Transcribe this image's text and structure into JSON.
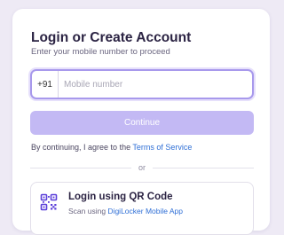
{
  "login": {
    "title": "Login or Create Account",
    "subtitle": "Enter your mobile number to proceed",
    "country_code": "+91",
    "phone_placeholder": "Mobile number",
    "phone_value": "",
    "continue_label": "Continue",
    "terms_prefix": "By continuing, I agree to the ",
    "terms_link": "Terms of Service",
    "divider_text": "or",
    "qr": {
      "icon": "qr-code-icon",
      "title": "Login using QR Code",
      "subtitle_prefix": "Scan using ",
      "subtitle_link": "DigiLocker Mobile App"
    }
  },
  "colors": {
    "accent": "#a899ec",
    "button_disabled": "#c3b9f4",
    "link": "#2f6fd6",
    "background": "#eeeaf5"
  }
}
